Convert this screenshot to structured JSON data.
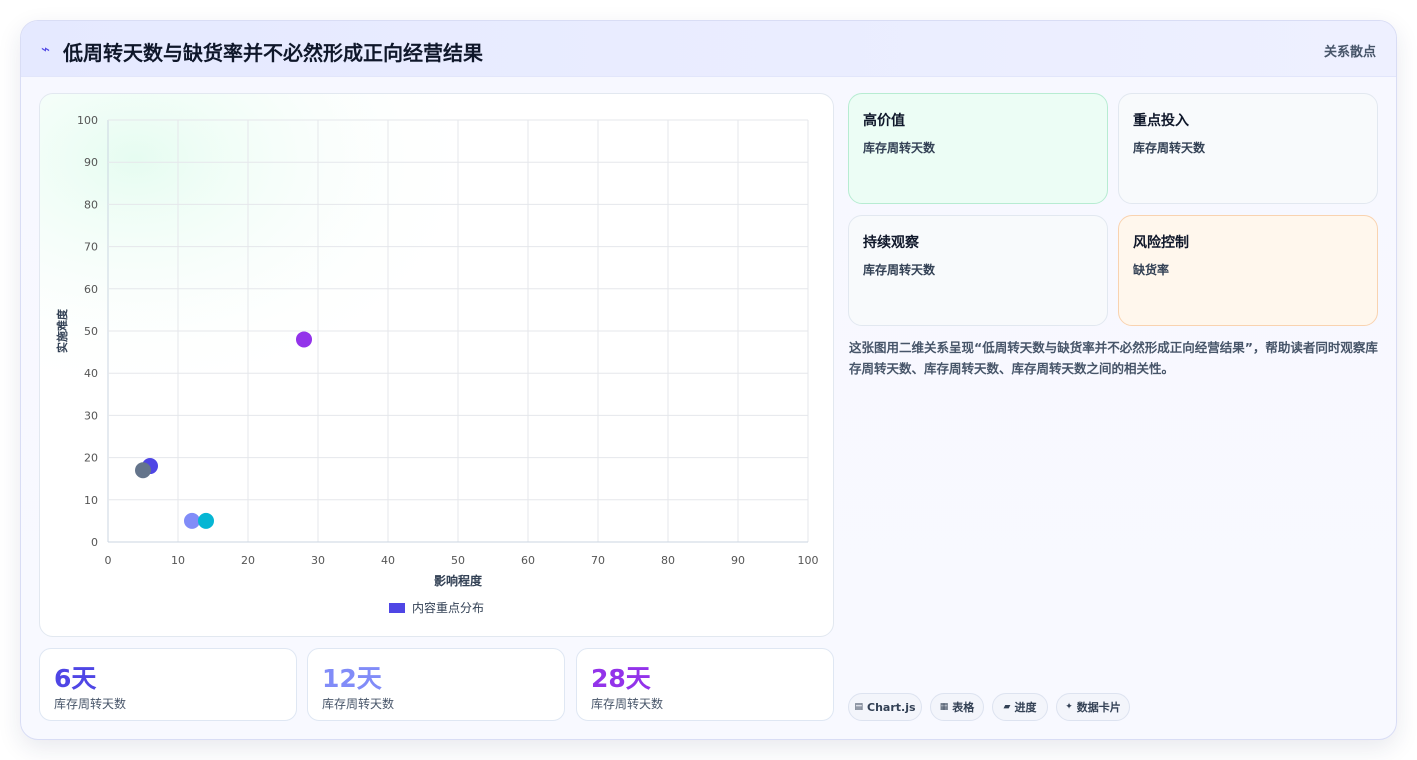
{
  "header": {
    "icon": "lightning-icon",
    "title": "低周转天数与缺货率并不必然形成正向经营结果",
    "tag": "关系散点"
  },
  "chart_data": {
    "type": "scatter",
    "xlabel": "影响程度",
    "ylabel": "实施难度",
    "xlim": [
      0,
      100
    ],
    "ylim": [
      0,
      100
    ],
    "xticks": [
      "0",
      "10",
      "20",
      "30",
      "40",
      "50",
      "60",
      "70",
      "80",
      "90",
      "100"
    ],
    "yticks": [
      "0",
      "10",
      "20",
      "30",
      "40",
      "50",
      "60",
      "70",
      "80",
      "90",
      "100"
    ],
    "grid": true,
    "legend_position": "bottom",
    "series": [
      {
        "name": "内容重点分布",
        "color": "#4f46e5",
        "points": [
          {
            "x": 6,
            "y": 18,
            "color": "#4f46e5"
          },
          {
            "x": 12,
            "y": 5,
            "color": "#818cf8"
          },
          {
            "x": 28,
            "y": 48,
            "color": "#9333ea"
          },
          {
            "x": 14,
            "y": 5,
            "color": "#06b6d4"
          },
          {
            "x": 5,
            "y": 17,
            "color": "#64748b"
          }
        ]
      }
    ]
  },
  "stats": [
    {
      "value": "6天",
      "label": "库存周转天数",
      "color": "#4f46e5"
    },
    {
      "value": "12天",
      "label": "库存周转天数",
      "color": "#818cf8"
    },
    {
      "value": "28天",
      "label": "库存周转天数",
      "color": "#9333ea"
    }
  ],
  "quadrants": [
    {
      "title": "高价值",
      "sub": "库存周转天数"
    },
    {
      "title": "重点投入",
      "sub": "库存周转天数"
    },
    {
      "title": "持续观察",
      "sub": "库存周转天数"
    },
    {
      "title": "风险控制",
      "sub": "缺货率"
    }
  ],
  "description": "这张图用二维关系呈现“低周转天数与缺货率并不必然形成正向经营结果”，帮助读者同时观察库存周转天数、库存周转天数、库存周转天数之间的相关性。",
  "chips": [
    {
      "icon": "chart-icon",
      "glyph": "▤",
      "label": "Chart.js"
    },
    {
      "icon": "table-icon",
      "glyph": "▦",
      "label": "表格"
    },
    {
      "icon": "progress-icon",
      "glyph": "▰",
      "label": "进度"
    },
    {
      "icon": "sparkle-icon",
      "glyph": "✦",
      "label": "数据卡片"
    }
  ]
}
